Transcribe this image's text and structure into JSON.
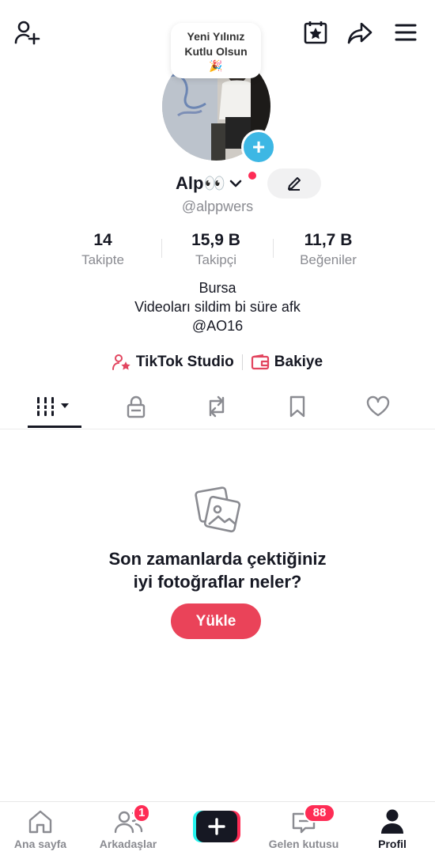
{
  "header": {
    "status_bubble": "Yeni Yılınız Kutlu Olsun",
    "status_emoji": "🎉"
  },
  "profile": {
    "display_name": "Alp👀",
    "username": "@alppwers"
  },
  "stats": [
    {
      "value": "14",
      "label": "Takipte"
    },
    {
      "value": "15,9 B",
      "label": "Takipçi"
    },
    {
      "value": "11,7 B",
      "label": "Beğeniler"
    }
  ],
  "bio": {
    "line1": "Bursa",
    "line2": "Videoları sildim bi süre afk",
    "line3": "@AO16"
  },
  "links": {
    "studio": "TikTok Studio",
    "balance": "Bakiye"
  },
  "empty_state": {
    "line1": "Son zamanlarda çektiğiniz",
    "line2": "iyi fotoğraflar neler?",
    "button": "Yükle"
  },
  "nav": {
    "home": "Ana sayfa",
    "friends": "Arkadaşlar",
    "friends_badge": "1",
    "inbox": "Gelen kutusu",
    "inbox_badge": "88",
    "profile": "Profil"
  },
  "colors": {
    "accent": "#fe2c55",
    "cyan": "#3db7e4",
    "upload_button": "#ea4359"
  }
}
